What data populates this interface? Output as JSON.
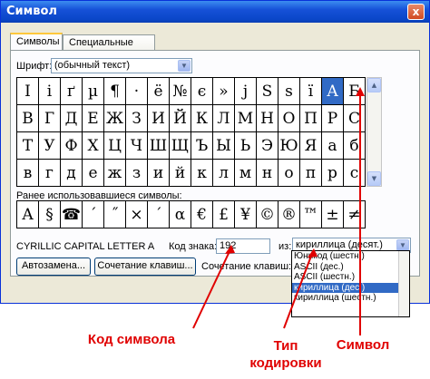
{
  "window": {
    "title": "Символ",
    "close_label": "x"
  },
  "tabs": [
    {
      "label": "Символы"
    },
    {
      "label": "Специальные знаки"
    }
  ],
  "font_label": "Шрифт:",
  "font_value": "(обычный текст)",
  "char_grid": [
    [
      "I",
      "i",
      "ґ",
      "µ",
      "¶",
      "·",
      "ё",
      "№",
      "є",
      "»",
      "ј",
      "Ѕ",
      "ѕ",
      "ї",
      "А",
      "Б"
    ],
    [
      "В",
      "Г",
      "Д",
      "Е",
      "Ж",
      "З",
      "И",
      "Й",
      "К",
      "Л",
      "М",
      "Н",
      "О",
      "П",
      "Р",
      "С"
    ],
    [
      "Т",
      "У",
      "Ф",
      "Х",
      "Ц",
      "Ч",
      "Ш",
      "Щ",
      "Ъ",
      "Ы",
      "Ь",
      "Э",
      "Ю",
      "Я",
      "а",
      "б"
    ],
    [
      "в",
      "г",
      "д",
      "е",
      "ж",
      "з",
      "и",
      "й",
      "к",
      "л",
      "м",
      "н",
      "о",
      "п",
      "р",
      "с"
    ]
  ],
  "selected_char": "А",
  "recent_label": "Ранее использовавшиеся символы:",
  "recent_chars": [
    "А",
    "§",
    "☎",
    "´",
    "˝",
    "×",
    "´",
    "α",
    "€",
    "£",
    "¥",
    "©",
    "®",
    "™",
    "±",
    "≠"
  ],
  "char_name": "CYRILLIC CAPITAL LETTER A",
  "code_label": "Код знака:",
  "code_value": "192",
  "from_label": "из:",
  "encoding_value": "кириллица (десят.)",
  "encoding_options": [
    "Юникод (шестн.)",
    "ASCII (дес.)",
    "ASCII (шестн.)",
    "кириллица (дес.)",
    "кириллица (шестн.)"
  ],
  "encoding_selected_index": 3,
  "autocorrect_button": "Автозамена...",
  "shortcut_button": "Сочетание клавиш...",
  "shortcut_label": "Сочетание клавиш: Shi",
  "annotations": {
    "code": "Код символа",
    "encoding": "Тип кодировки",
    "symbol": "Символ"
  },
  "colors": {
    "annotation": "#e00000",
    "selection": "#316ac5"
  }
}
